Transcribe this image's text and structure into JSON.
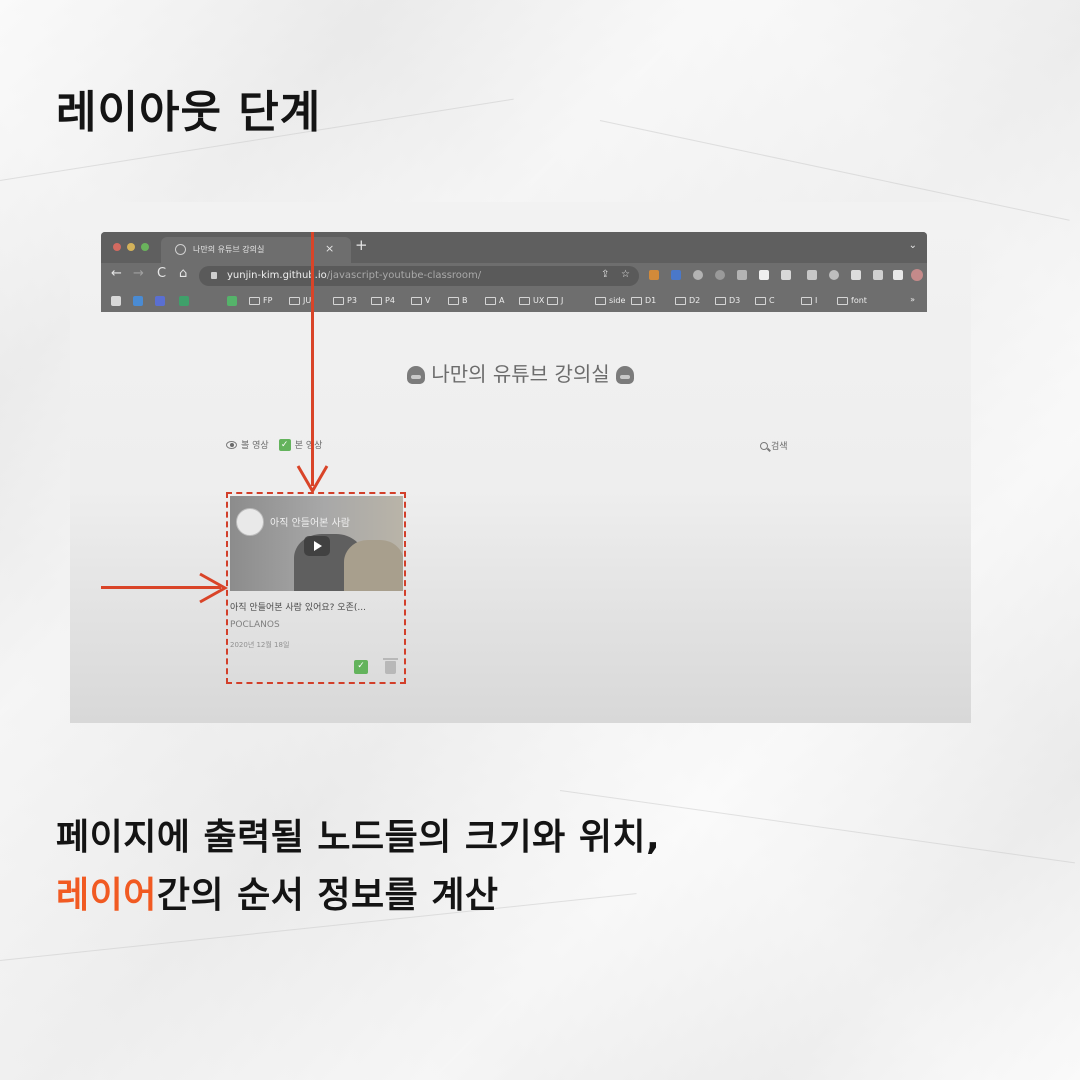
{
  "heading": "레이아웃 단계",
  "browser": {
    "tab_title": "나만의 유튜브 강의실",
    "tab_close": "×",
    "tab_new": "+",
    "tab_menu": "⌄",
    "nav": {
      "back": "←",
      "forward": "→",
      "reload": "C",
      "home": "⌂"
    },
    "url_host": "yunjin-kim.github.io",
    "url_path": "/javascript-youtube-classroom/",
    "bookmarks": [
      "FP",
      "JU",
      "P3",
      "P4",
      "V",
      "B",
      "A",
      "UX",
      "J",
      "side",
      "D1",
      "D2",
      "D3",
      "C",
      "I",
      "font"
    ],
    "bookmarks_more": "»"
  },
  "page": {
    "title": "나만의 유튜브 강의실",
    "tabs": [
      {
        "label": "볼 영상",
        "icon": "eye-icon"
      },
      {
        "label": "본 영상",
        "icon": "check-icon"
      }
    ],
    "search_label": "검색"
  },
  "video": {
    "thumb_title": "아직 안들어본 사람",
    "title": "아직 안들어본 사람 있어요? 오존(...",
    "channel": "POCLANOS",
    "date": "2020년 12월 18일"
  },
  "caption": {
    "line1": "페이지에 출력될 노드들의 크기와 위치,",
    "line2_accent": "레이어",
    "line2_rest": "간의 순서 정보를 계산"
  },
  "colors": {
    "accent": "#f15a22",
    "arrow": "#d94428",
    "heading": "#141414"
  }
}
